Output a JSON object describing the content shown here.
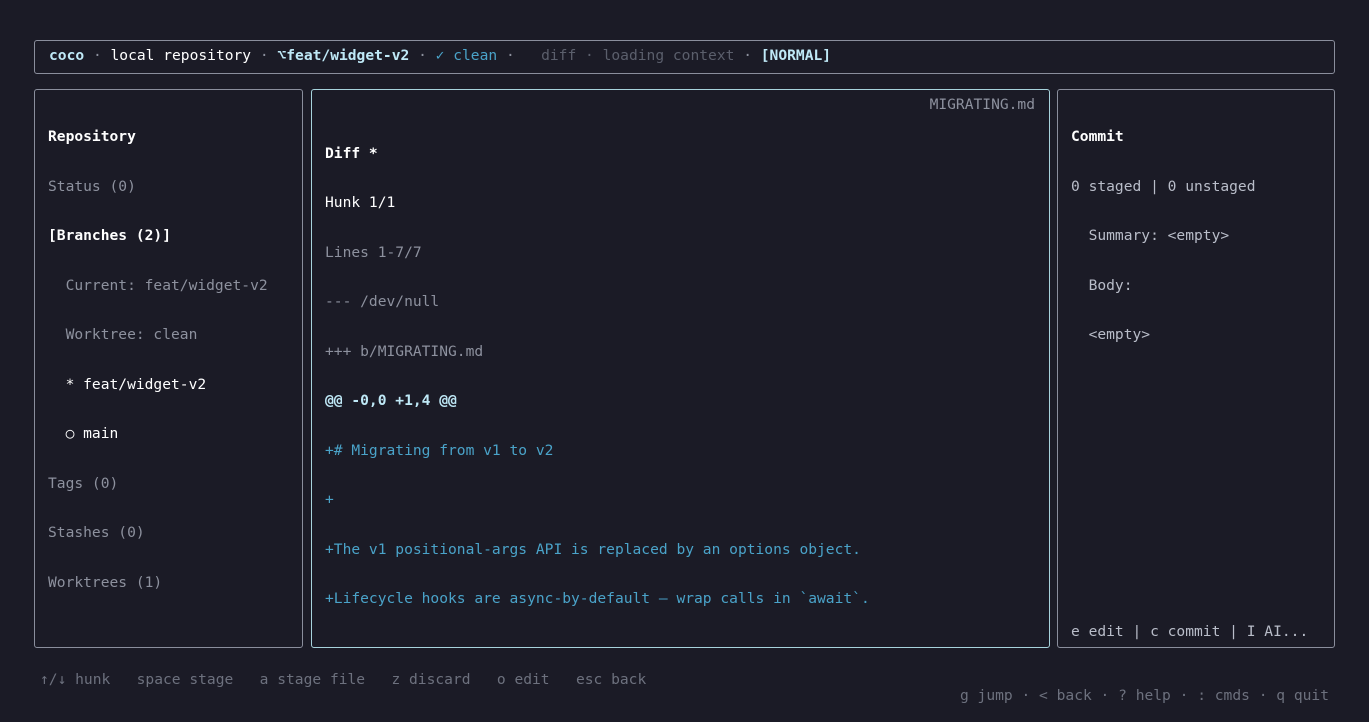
{
  "header": {
    "app": "coco",
    "sep": " · ",
    "repo": "local repository",
    "branch_icon": "⌥",
    "branch": "feat/widget-v2",
    "status": "✓ clean",
    "view": "diff",
    "loading": "loading context",
    "mode": "[NORMAL]"
  },
  "sidebar": {
    "title": "Repository",
    "status": "Status (0)",
    "branches_header": "[Branches (2)]",
    "current": "  Current: feat/widget-v2",
    "worktree": "  Worktree: clean",
    "branch_items": [
      {
        "label": "  * feat/widget-v2"
      },
      {
        "label": "  ○ main"
      }
    ],
    "tags": "Tags (0)",
    "stashes": "Stashes (0)",
    "worktrees": "Worktrees (1)"
  },
  "diff": {
    "title": "Diff *",
    "file": "MIGRATING.md",
    "hunk": "Hunk 1/1",
    "lines_range": "Lines 1-7/7",
    "old_file": "--- /dev/null",
    "new_file": "+++ b/MIGRATING.md",
    "hunk_header": "@@ -0,0 +1,4 @@",
    "added": [
      "+# Migrating from v1 to v2",
      "+",
      "+The v1 positional-args API is replaced by an options object.",
      "+Lifecycle hooks are async-by-default — wrap calls in `await`."
    ]
  },
  "commit": {
    "title": "Commit",
    "counts": "0 staged | 0 unstaged",
    "summary": "  Summary: <empty>",
    "body_label": "  Body:",
    "body_value": "  <empty>",
    "footer": "e edit | c commit | I AI..."
  },
  "footer": {
    "left": "↑/↓ hunk   space stage   a stage file   z discard   o edit   esc back",
    "right": "g jump · < back · ? help · : cmds · q quit"
  }
}
